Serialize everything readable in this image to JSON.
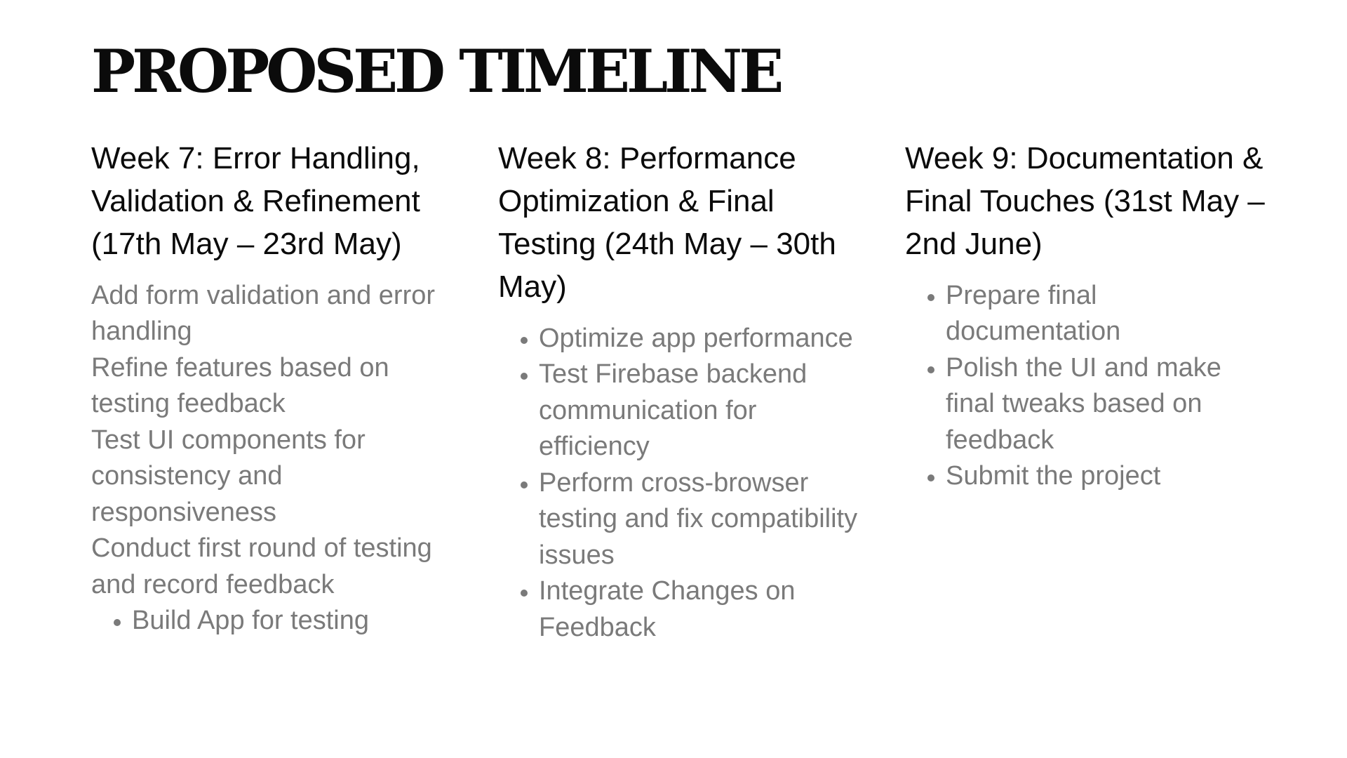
{
  "title": "PROPOSED TIMELINE",
  "columns": [
    {
      "heading": "Week 7: Error Handling, Validation & Refinement (17th May – 23rd May)",
      "lines": [
        "Add form validation and error handling",
        "Refine features based on testing feedback",
        "Test UI components for consistency and responsiveness",
        "Conduct first round of testing and record feedback"
      ],
      "bullets": [
        "Build App for testing"
      ]
    },
    {
      "heading": "Week 8: Performance Optimization & Final Testing (24th May – 30th May)",
      "bullets": [
        "Optimize app performance",
        "Test Firebase backend communication for efficiency",
        "Perform cross-browser testing and fix compatibility issues",
        "Integrate Changes on Feedback"
      ]
    },
    {
      "heading": "Week 9: Documentation & Final Touches (31st May – 2nd June)",
      "bullets": [
        "Prepare final documentation",
        "Polish the UI and make final tweaks based on feedback",
        "Submit the project"
      ]
    }
  ]
}
